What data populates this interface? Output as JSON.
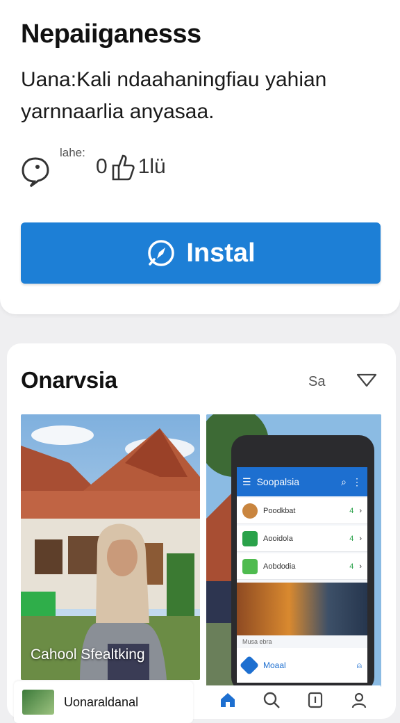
{
  "app": {
    "title": "Nepaiiganesss",
    "description_lead": "Uana:",
    "description_rest": "Kali ndaahaningfiau yahian yarnnaarlia anyasaa.",
    "meta_label": "lahe:",
    "like_prefix": "0",
    "like_count": "1lü",
    "install_label": "Instal"
  },
  "section": {
    "title": "Onarvsia",
    "more_label": "Sa"
  },
  "screenshot1": {
    "caption": "Cahool Sfealtking"
  },
  "screenshot2": {
    "header_title": "Soopalsia",
    "rows": [
      {
        "label": "Poodkbat",
        "badge": "4"
      },
      {
        "label": "Aooidola",
        "badge": "4"
      },
      {
        "label": "Aobdodia",
        "badge": "4"
      }
    ],
    "caption": "Musa ebra",
    "footer_label": "Moaal"
  },
  "mini_card": {
    "label": "Uonaraldanal"
  },
  "colors": {
    "accent": "#1d7fd6",
    "background": "#efeff1"
  }
}
